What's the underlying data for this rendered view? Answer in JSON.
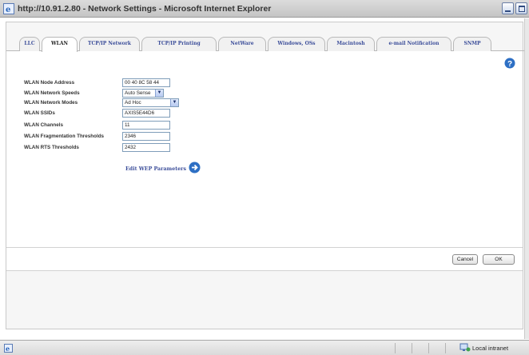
{
  "window": {
    "title": "http://10.91.2.80 - Network Settings - Microsoft Internet Explorer"
  },
  "tabs": [
    {
      "label": "LLC",
      "active": false
    },
    {
      "label": "WLAN",
      "active": true
    },
    {
      "label": "TCP/IP Network",
      "active": false
    },
    {
      "label": "TCP/IP Printing",
      "active": false
    },
    {
      "label": "NetWare",
      "active": false
    },
    {
      "label": "Windows, OSs",
      "active": false
    },
    {
      "label": "Macintosh",
      "active": false
    },
    {
      "label": "e-mail Notification",
      "active": false
    },
    {
      "label": "SNMP",
      "active": false
    }
  ],
  "form": {
    "node_address": {
      "label": "WLAN Node Address",
      "value": "00 40 8C 58 44"
    },
    "network_speeds": {
      "label": "WLAN Network Speeds",
      "value": "Auto Sense"
    },
    "network_modes": {
      "label": "WLAN Network Modes",
      "value": "Ad Hoc"
    },
    "ssids": {
      "label": "WLAN SSIDs",
      "value": "AXIS5E44D6"
    },
    "channels": {
      "label": "WLAN Channels",
      "value": "11"
    },
    "fragmentation": {
      "label": "WLAN Fragmentation Thresholds",
      "value": "2346"
    },
    "rts": {
      "label": "WLAN RTS Thresholds",
      "value": "2432"
    }
  },
  "edit_wep_label": "Edit WEP Parameters",
  "buttons": {
    "cancel": "Cancel",
    "ok": "OK"
  },
  "status": {
    "zone": "Local intranet"
  },
  "icons": {
    "browser": "ie-icon",
    "help": "help-icon",
    "edit_arrow": "arrow-right-circle-icon",
    "zone": "intranet-icon"
  },
  "colors": {
    "tab_text": "#3c4e9a",
    "link": "#3c4e9a",
    "help": "#2d6fc4"
  }
}
